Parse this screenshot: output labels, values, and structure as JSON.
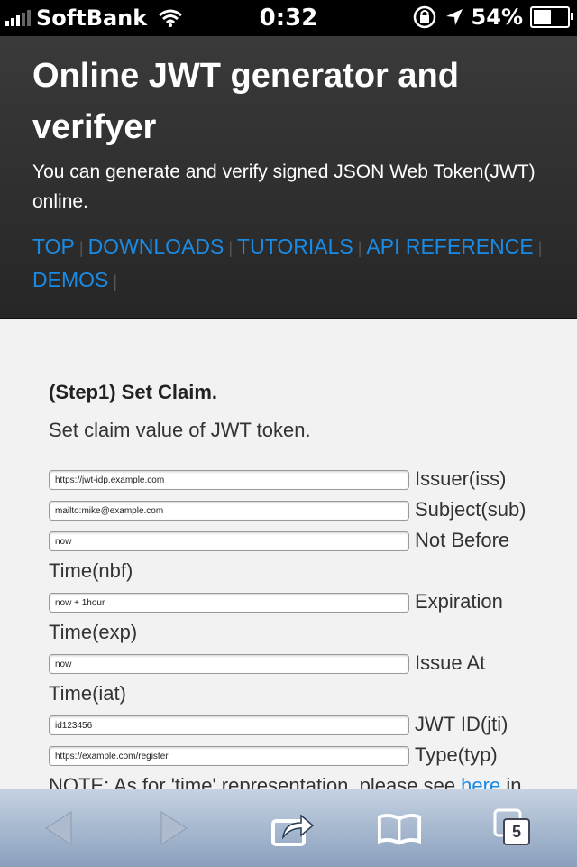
{
  "status_bar": {
    "carrier": "SoftBank",
    "time": "0:32",
    "battery": "54%",
    "battery_level": 0.54
  },
  "header": {
    "title": "Online JWT generator and verifyer",
    "description": "You can generate and verify signed JSON Web Token(JWT) online.",
    "nav": [
      "TOP",
      "DOWNLOADS",
      "TUTORIALS",
      "API REFERENCE",
      "DEMOS"
    ]
  },
  "step1": {
    "title": "(Step1) Set Claim.",
    "description": "Set claim value of JWT token.",
    "fields": [
      {
        "value": "https://jwt-idp.example.com",
        "label": "Issuer(iss)"
      },
      {
        "value": "mailto:mike@example.com",
        "label": "Subject(sub)"
      },
      {
        "value": "now",
        "label": "Not Before Time(nbf)"
      },
      {
        "value": "now + 1hour",
        "label": "Expiration Time(exp)"
      },
      {
        "value": "now",
        "label": "Issue At Time(iat)"
      },
      {
        "value": "id123456",
        "label": "JWT ID(jti)"
      },
      {
        "value": "https://example.com/register",
        "label": "Type(typ)"
      }
    ],
    "note_prefix": "NOTE: As for 'time' representation, please see ",
    "note_link": "here",
    "note_suffix": " in"
  },
  "toolbar": {
    "tab_count": "5",
    "colors": {
      "accent": "#1a8be5"
    }
  }
}
